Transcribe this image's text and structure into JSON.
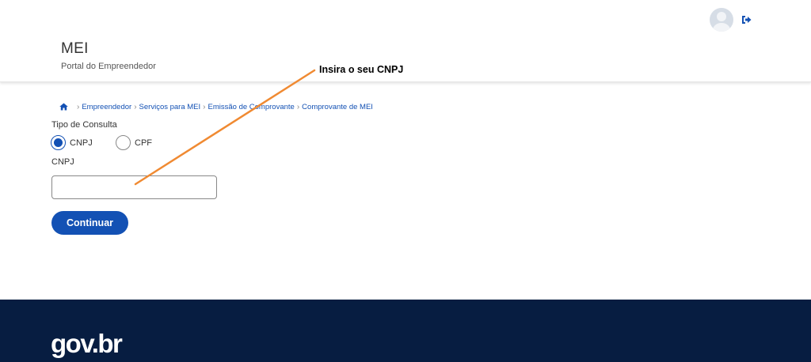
{
  "header": {
    "title": "MEI",
    "subtitle": "Portal do Empreendedor",
    "avatar_icon": "user-avatar-icon",
    "logout_icon": "sign-out-icon"
  },
  "breadcrumb": {
    "home_icon": "home-icon",
    "items": [
      {
        "label": "Empreendedor"
      },
      {
        "label": "Serviços para MEI"
      },
      {
        "label": "Emissão de Comprovante"
      },
      {
        "label": "Comprovante de MEI"
      }
    ]
  },
  "form": {
    "consulta_label": "Tipo de Consulta",
    "options": [
      {
        "label": "CNPJ",
        "selected": true
      },
      {
        "label": "CPF",
        "selected": false
      }
    ],
    "cnpj_label": "CNPJ",
    "cnpj_value": "",
    "cnpj_placeholder": "",
    "submit_label": "Continuar"
  },
  "annotation": {
    "text": "Insira o seu CNPJ",
    "color": "#f08a32"
  },
  "footer": {
    "logo": "gov.br"
  },
  "colors": {
    "primary": "#1351b4",
    "footer_bg": "#071d41"
  }
}
